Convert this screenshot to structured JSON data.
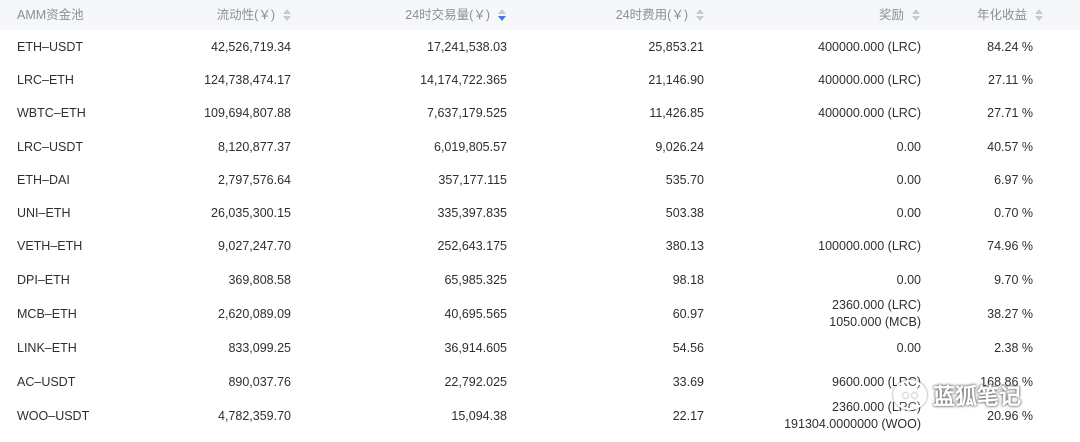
{
  "header": {
    "pool": "AMM资金池",
    "liquidity": "流动性(￥)",
    "volume": "24时交易量(￥)",
    "fees": "24时费用(￥)",
    "reward": "奖励",
    "apy": "年化收益"
  },
  "rows": [
    {
      "pool": "ETH–USDT",
      "liquidity": "42,526,719.34",
      "volume": "17,241,538.03",
      "fees": "25,853.21",
      "reward": [
        "400000.000 (LRC)"
      ],
      "apy": "84.24 %"
    },
    {
      "pool": "LRC–ETH",
      "liquidity": "124,738,474.17",
      "volume": "14,174,722.365",
      "fees": "21,146.90",
      "reward": [
        "400000.000 (LRC)"
      ],
      "apy": "27.11 %"
    },
    {
      "pool": "WBTC–ETH",
      "liquidity": "109,694,807.88",
      "volume": "7,637,179.525",
      "fees": "11,426.85",
      "reward": [
        "400000.000 (LRC)"
      ],
      "apy": "27.71 %"
    },
    {
      "pool": "LRC–USDT",
      "liquidity": "8,120,877.37",
      "volume": "6,019,805.57",
      "fees": "9,026.24",
      "reward": [
        "0.00"
      ],
      "apy": "40.57 %"
    },
    {
      "pool": "ETH–DAI",
      "liquidity": "2,797,576.64",
      "volume": "357,177.115",
      "fees": "535.70",
      "reward": [
        "0.00"
      ],
      "apy": "6.97 %"
    },
    {
      "pool": "UNI–ETH",
      "liquidity": "26,035,300.15",
      "volume": "335,397.835",
      "fees": "503.38",
      "reward": [
        "0.00"
      ],
      "apy": "0.70 %"
    },
    {
      "pool": "VETH–ETH",
      "liquidity": "9,027,247.70",
      "volume": "252,643.175",
      "fees": "380.13",
      "reward": [
        "100000.000 (LRC)"
      ],
      "apy": "74.96 %"
    },
    {
      "pool": "DPI–ETH",
      "liquidity": "369,808.58",
      "volume": "65,985.325",
      "fees": "98.18",
      "reward": [
        "0.00"
      ],
      "apy": "9.70 %"
    },
    {
      "pool": "MCB–ETH",
      "liquidity": "2,620,089.09",
      "volume": "40,695.565",
      "fees": "60.97",
      "reward": [
        "2360.000 (LRC)",
        "1050.000 (MCB)"
      ],
      "apy": "38.27 %"
    },
    {
      "pool": "LINK–ETH",
      "liquidity": "833,099.25",
      "volume": "36,914.605",
      "fees": "54.56",
      "reward": [
        "0.00"
      ],
      "apy": "2.38 %"
    },
    {
      "pool": "AC–USDT",
      "liquidity": "890,037.76",
      "volume": "22,792.025",
      "fees": "33.69",
      "reward": [
        "9600.000 (LRC)"
      ],
      "apy": "168.86 %"
    },
    {
      "pool": "WOO–USDT",
      "liquidity": "4,782,359.70",
      "volume": "15,094.38",
      "fees": "22.17",
      "reward": [
        "2360.000 (LRC)",
        "191304.0000000 (WOO)"
      ],
      "apy": "20.96 %"
    }
  ],
  "watermark": {
    "text": "蓝狐笔记",
    "icon": "wechat-icon"
  },
  "colors": {
    "header_bg": "#f5f7fa",
    "header_text": "#8a8f99",
    "body_text": "#2b2f36",
    "sort_active": "#3d7be0"
  }
}
